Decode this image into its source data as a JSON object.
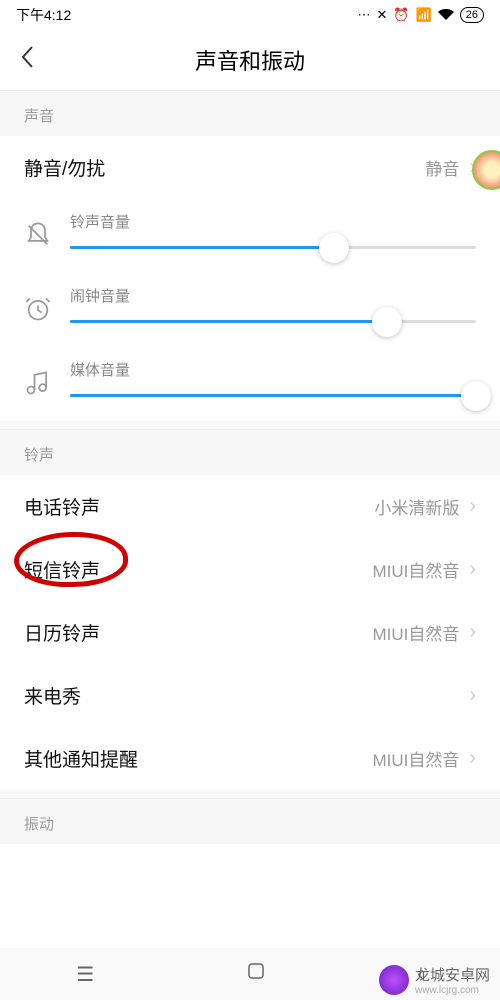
{
  "status": {
    "time": "下午4:12",
    "battery": "26"
  },
  "header": {
    "title": "声音和振动"
  },
  "sections": {
    "sound": {
      "header": "声音",
      "silent": {
        "label": "静音/勿扰",
        "value": "静音"
      },
      "sliders": {
        "ring": {
          "label": "铃声音量",
          "percent": 65
        },
        "alarm": {
          "label": "闹钟音量",
          "percent": 78
        },
        "media": {
          "label": "媒体音量",
          "percent": 100
        }
      }
    },
    "ringtone": {
      "header": "铃声",
      "phone": {
        "label": "电话铃声",
        "value": "小米清新版"
      },
      "sms": {
        "label": "短信铃声",
        "value": "MIUI自然音"
      },
      "calendar": {
        "label": "日历铃声",
        "value": "MIUI自然音"
      },
      "callshow": {
        "label": "来电秀",
        "value": ""
      },
      "other": {
        "label": "其他通知提醒",
        "value": "MIUI自然音"
      }
    },
    "vibration": {
      "header": "振动"
    }
  },
  "watermark": {
    "text": "龙城安卓网",
    "url": "www.lcjrg.com"
  }
}
